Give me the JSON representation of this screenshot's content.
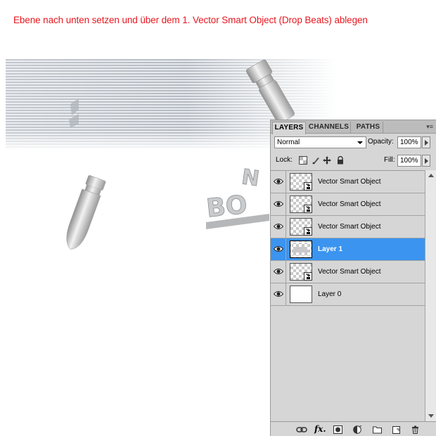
{
  "instruction": "Ebene nach unten setzen und über dem 1. Vector Smart Object (Drop Beats) ablegen",
  "panel": {
    "tabs": [
      {
        "label": "LAYERS",
        "active": true
      },
      {
        "label": "CHANNELS",
        "active": false
      },
      {
        "label": "PATHS",
        "active": false
      }
    ],
    "menu_icon": "▾≡",
    "blend_mode": "Normal",
    "opacity_label": "Opacity:",
    "opacity_value": "100%",
    "lock_label": "Lock:",
    "fill_label": "Fill:",
    "fill_value": "100%",
    "lock_icons": [
      "lock-transparent-icon",
      "lock-image-icon",
      "lock-position-icon",
      "lock-all-icon"
    ],
    "layers": [
      {
        "name": "Vector Smart Object",
        "type": "smart",
        "visible": true,
        "selected": false
      },
      {
        "name": "Vector Smart Object",
        "type": "smart",
        "visible": true,
        "selected": false
      },
      {
        "name": "Vector Smart Object",
        "type": "smart",
        "visible": true,
        "selected": false
      },
      {
        "name": "Layer 1",
        "type": "raster",
        "visible": true,
        "selected": true
      },
      {
        "name": "Vector Smart Object",
        "type": "smart",
        "visible": true,
        "selected": false
      },
      {
        "name": "Layer 0",
        "type": "plain",
        "visible": true,
        "selected": false
      }
    ],
    "bottom_icons": [
      "link-layers-icon",
      "fx-icon",
      "mask-icon",
      "adjustment-icon",
      "group-folder-icon",
      "new-layer-icon",
      "trash-icon"
    ],
    "fx_text": "fx.",
    "selection_color": "#3b94ef"
  }
}
